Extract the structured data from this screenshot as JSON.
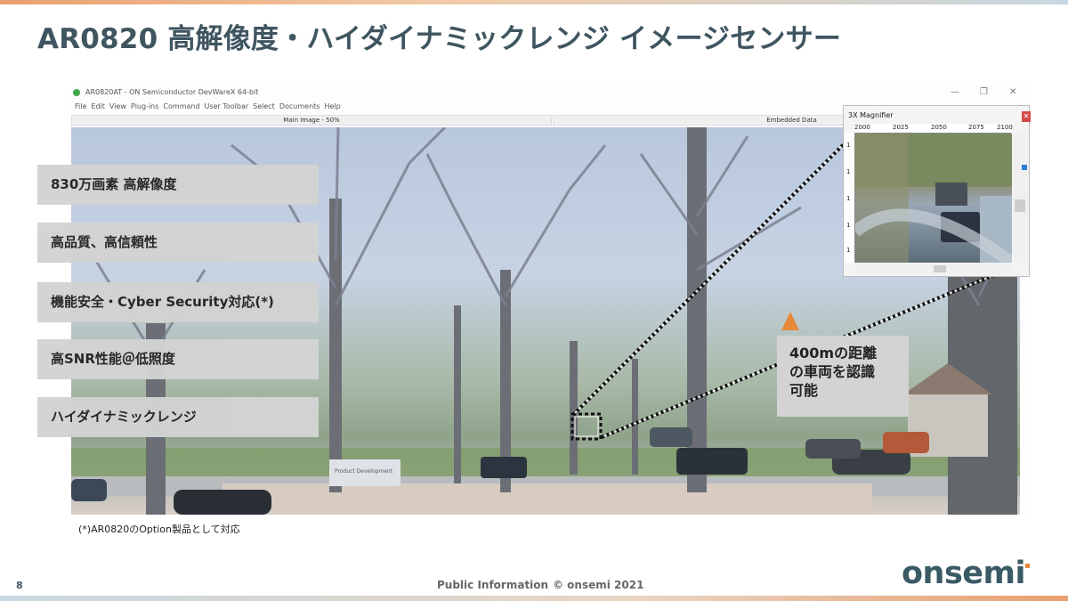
{
  "slide": {
    "title": "AR0820 高解像度・ハイダイナミックレンジ イメージセンサー",
    "page_number": "8",
    "footer_classification": "Public Information",
    "footer_copyright": "© onsemi 2021",
    "footnote": "(*)AR0820のOption製品として対応",
    "logo_text": "onsemi",
    "accent_color": "#e8883a",
    "title_color": "#3f5560"
  },
  "app_window": {
    "title": "AR0820AT - ON Semiconductor DevWareX 64-bit",
    "menu": [
      "File",
      "Edit",
      "View",
      "Plug-ins",
      "Command",
      "User Toolbar",
      "Select",
      "Documents",
      "Help"
    ],
    "panels": {
      "main_image_label": "Main Image - 50%",
      "embedded_data_label": "Embedded Data"
    },
    "controls": {
      "minimize": "—",
      "maximize": "❐",
      "close": "✕"
    }
  },
  "features": [
    "830万画素 高解像度",
    "高品質、高信頼性",
    "機能安全・Cyber Security対応(*)",
    "高SNR性能＠低照度",
    "ハイダイナミックレンジ"
  ],
  "callout": {
    "text": "400mの距離\nの車両を認識\n可能"
  },
  "magnifier": {
    "title": "3X Magnifier",
    "close_label": "✕",
    "ruler_x": [
      "2000",
      "2025",
      "2050",
      "2075",
      "2100"
    ],
    "ruler_y": [
      "1",
      "1",
      "1",
      "1",
      "1"
    ]
  },
  "scene": {
    "sign_text": "Product Development"
  }
}
